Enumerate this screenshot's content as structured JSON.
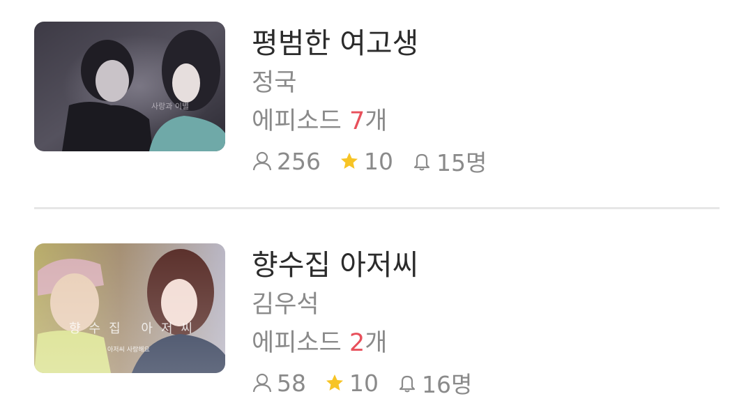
{
  "items": [
    {
      "title": "평범한 여고생",
      "author": "정국",
      "episodes_prefix": "에피소드 ",
      "episodes_count": "7",
      "episodes_suffix": "개",
      "readers": "256",
      "rating": "10",
      "subscribers": "15명"
    },
    {
      "title": "향수집 아저씨",
      "author": "김우석",
      "episodes_prefix": "에피소드 ",
      "episodes_count": "2",
      "episodes_suffix": "개",
      "readers": "58",
      "rating": "10",
      "subscribers": "16명"
    }
  ],
  "colors": {
    "accent": "#e8505b",
    "star": "#f7c425",
    "text_primary": "#2b2b2b",
    "text_secondary": "#8a8a8a"
  },
  "icons": {
    "readers": "person-icon",
    "rating": "star-icon",
    "subscribers": "bell-icon"
  }
}
